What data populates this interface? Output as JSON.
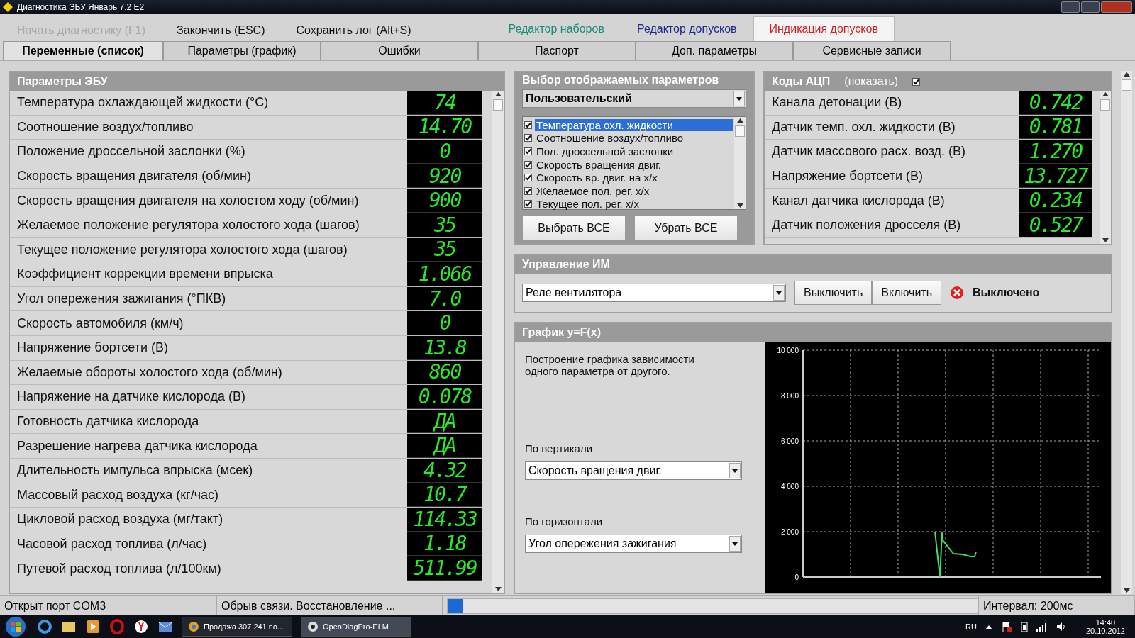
{
  "window": {
    "title": "Диагностика ЭБУ Январь 7.2 E2"
  },
  "toolbar": [
    {
      "label": "Начать диагностику (F1)",
      "disabled": true
    },
    {
      "label": "Закончить (ESC)",
      "disabled": false
    },
    {
      "label": "Сохранить лог (Alt+S)",
      "disabled": false
    }
  ],
  "mode_tabs": [
    {
      "label": "Редактор наборов",
      "color": "#1a8a7a",
      "selected": false
    },
    {
      "label": "Редактор допусков",
      "color": "#1a2a8a",
      "selected": false
    },
    {
      "label": "Индикация допусков",
      "color": "#d02020",
      "selected": true
    }
  ],
  "tabs": [
    {
      "label": "Переменные (список)",
      "selected": true
    },
    {
      "label": "Параметры (график)",
      "selected": false
    },
    {
      "label": "Ошибки",
      "selected": false
    },
    {
      "label": "Паспорт",
      "selected": false
    },
    {
      "label": "Доп. параметры",
      "selected": false
    },
    {
      "label": "Сервисные записи",
      "selected": false
    }
  ],
  "ecu_panel": {
    "title": "Параметры ЭБУ",
    "rows": [
      {
        "name": "Температура охлаждающей жидкости (°C)",
        "value": "74"
      },
      {
        "name": "Соотношение воздух/топливо",
        "value": "14.70"
      },
      {
        "name": "Положение дроссельной заслонки (%)",
        "value": "0"
      },
      {
        "name": "Скорость вращения двигателя (об/мин)",
        "value": "920"
      },
      {
        "name": "Скорость вращения двигателя на холостом ходу (об/мин)",
        "value": "900"
      },
      {
        "name": "Желаемое положение регулятора холостого хода (шагов)",
        "value": "35"
      },
      {
        "name": "Текущее положение регулятора холостого хода (шагов)",
        "value": "35"
      },
      {
        "name": "Коэффициент коррекции времени впрыска",
        "value": "1.066"
      },
      {
        "name": "Угол опережения зажигания (°ПКВ)",
        "value": "7.0"
      },
      {
        "name": "Скорость автомобиля (км/ч)",
        "value": "0"
      },
      {
        "name": "Напряжение бортсети (В)",
        "value": "13.8"
      },
      {
        "name": "Желаемые обороты холостого хода (об/мин)",
        "value": "860"
      },
      {
        "name": "Напряжение на датчике кислорода (В)",
        "value": "0.078"
      },
      {
        "name": "Готовность датчика кислорода",
        "value": "ДА"
      },
      {
        "name": "Разрешение нагрева датчика кислорода",
        "value": "ДА"
      },
      {
        "name": "Длительность импульса впрыска (мсек)",
        "value": "4.32"
      },
      {
        "name": "Массовый расход воздуха (кг/час)",
        "value": "10.7"
      },
      {
        "name": "Цикловой расход воздуха (мг/такт)",
        "value": "114.33"
      },
      {
        "name": "Часовой расход топлива (л/час)",
        "value": "1.18"
      },
      {
        "name": "Путевой расход топлива (л/100км)",
        "value": "511.99"
      }
    ]
  },
  "select_panel": {
    "title": "Выбор отображаемых параметров",
    "preset": "Пользовательский",
    "items": [
      {
        "label": "Температура охл. жидкости",
        "checked": true,
        "selected": true
      },
      {
        "label": "Соотношение воздух/топливо",
        "checked": true,
        "selected": false
      },
      {
        "label": "Пол. дроссельной заслонки",
        "checked": true,
        "selected": false
      },
      {
        "label": "Скорость вращения двиг.",
        "checked": true,
        "selected": false
      },
      {
        "label": "Скорость вр. двиг. на х/х",
        "checked": true,
        "selected": false
      },
      {
        "label": "Желаемое пол. рег. х/х",
        "checked": true,
        "selected": false
      },
      {
        "label": "Текущее пол. рег. х/х",
        "checked": true,
        "selected": false
      }
    ],
    "buttons": [
      "Выбрать ВСЕ",
      "Убрать ВСЕ"
    ]
  },
  "adc_panel": {
    "title": "Коды АЦП",
    "show_label": "(показать)",
    "show_checked": true,
    "rows": [
      {
        "name": "Канала детонации (В)",
        "value": "0.742"
      },
      {
        "name": "Датчик темп. охл. жидкости (В)",
        "value": "0.781"
      },
      {
        "name": "Датчик массового расх. возд. (В)",
        "value": "1.270"
      },
      {
        "name": "Напряжение бортсети (В)",
        "value": "13.727"
      },
      {
        "name": "Канал датчика кислорода (В)",
        "value": "0.234"
      },
      {
        "name": "Датчик положения дросселя (В)",
        "value": "0.527"
      }
    ]
  },
  "control_panel": {
    "title": "Управление ИМ",
    "device": "Реле вентилятора",
    "buttons": [
      "Выключить",
      "Включить"
    ],
    "status": "Выключено"
  },
  "graph_panel": {
    "title": "График y=F(x)",
    "description": "Построение графика зависимости одного параметра от другого.",
    "vertical_label": "По вертикали",
    "vertical_value": "Скорость вращения двиг.",
    "horizontal_label": "По горизонтали",
    "horizontal_value": "Угол опережения зажигания",
    "y_tick_labels": [
      "10 000",
      "8 000",
      "6 000",
      "4 000",
      "2 000",
      "0"
    ]
  },
  "status_bar": {
    "port": "Открыт порт COM3",
    "connection": "Обрыв связи. Восстановление ...",
    "level": 0.03,
    "interval": "Интервал: 200мс"
  },
  "taskbar": {
    "tasks": [
      {
        "label": "Продажа 307 241 по...",
        "selected": false
      },
      {
        "label": "OpenDiagPro-ELM",
        "selected": true
      }
    ],
    "language": "RU",
    "time": "14:40",
    "date": "20.10.2012"
  }
}
